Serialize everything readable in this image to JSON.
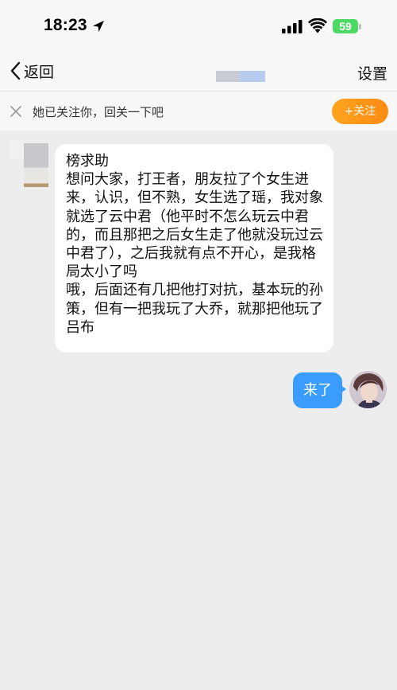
{
  "status_bar": {
    "time": "18:23",
    "battery": "59",
    "icons": [
      "location-arrow-icon",
      "signal-icon",
      "wifi-icon",
      "battery-icon"
    ]
  },
  "nav": {
    "back_label": "返回",
    "settings_label": "设置"
  },
  "follow_bar": {
    "text": "她已关注你，回关一下吧",
    "button_label": "+关注"
  },
  "messages": [
    {
      "side": "left",
      "text": "榜求助\n想问大家，打王者，朋友拉了个女生进来，认识，但不熟，女生选了瑶，我对象就选了云中君（他平时不怎么玩云中君的，而且那把之后女生走了他就没玩过云中君了），之后我就有点不开心，是我格局太小了吗\n哦，后面还有几把他打对抗，基本玩的孙策，但有一把我玩了大乔，就那把他玩了吕布"
    },
    {
      "side": "right",
      "text": "来了"
    }
  ],
  "colors": {
    "background": "#ededed",
    "bubble_left": "#ffffff",
    "bubble_right": "#3b9cff",
    "follow_button": "#ff9a1a",
    "battery": "#4cd964"
  }
}
